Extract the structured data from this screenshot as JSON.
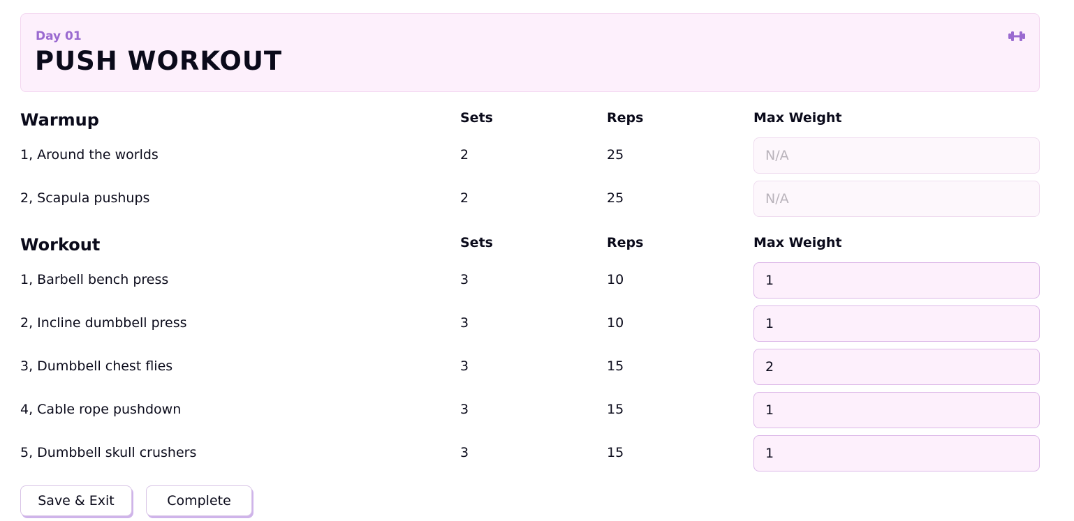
{
  "header": {
    "day_label": "Day 01",
    "title": "PUSH WORKOUT",
    "icon": "dumbbell-icon",
    "accent_color": "#9a6ad0",
    "background_color": "#fdf0fc"
  },
  "columns": {
    "sets": "Sets",
    "reps": "Reps",
    "max_weight": "Max Weight"
  },
  "warmup": {
    "title": "Warmup",
    "exercises": [
      {
        "name": "1, Around the worlds",
        "sets": "2",
        "reps": "25",
        "weight_placeholder": "N/A",
        "weight_value": ""
      },
      {
        "name": "2, Scapula pushups",
        "sets": "2",
        "reps": "25",
        "weight_placeholder": "N/A",
        "weight_value": ""
      }
    ]
  },
  "workout": {
    "title": "Workout",
    "exercises": [
      {
        "name": "1, Barbell bench press",
        "sets": "3",
        "reps": "10",
        "weight_value": "1"
      },
      {
        "name": "2, Incline dumbbell press",
        "sets": "3",
        "reps": "10",
        "weight_value": "1"
      },
      {
        "name": "3, Dumbbell chest flies",
        "sets": "3",
        "reps": "15",
        "weight_value": "2"
      },
      {
        "name": "4, Cable rope pushdown",
        "sets": "3",
        "reps": "15",
        "weight_value": "1"
      },
      {
        "name": "5, Dumbbell skull crushers",
        "sets": "3",
        "reps": "15",
        "weight_value": "1"
      }
    ]
  },
  "actions": {
    "save_exit": "Save & Exit",
    "complete": "Complete"
  }
}
